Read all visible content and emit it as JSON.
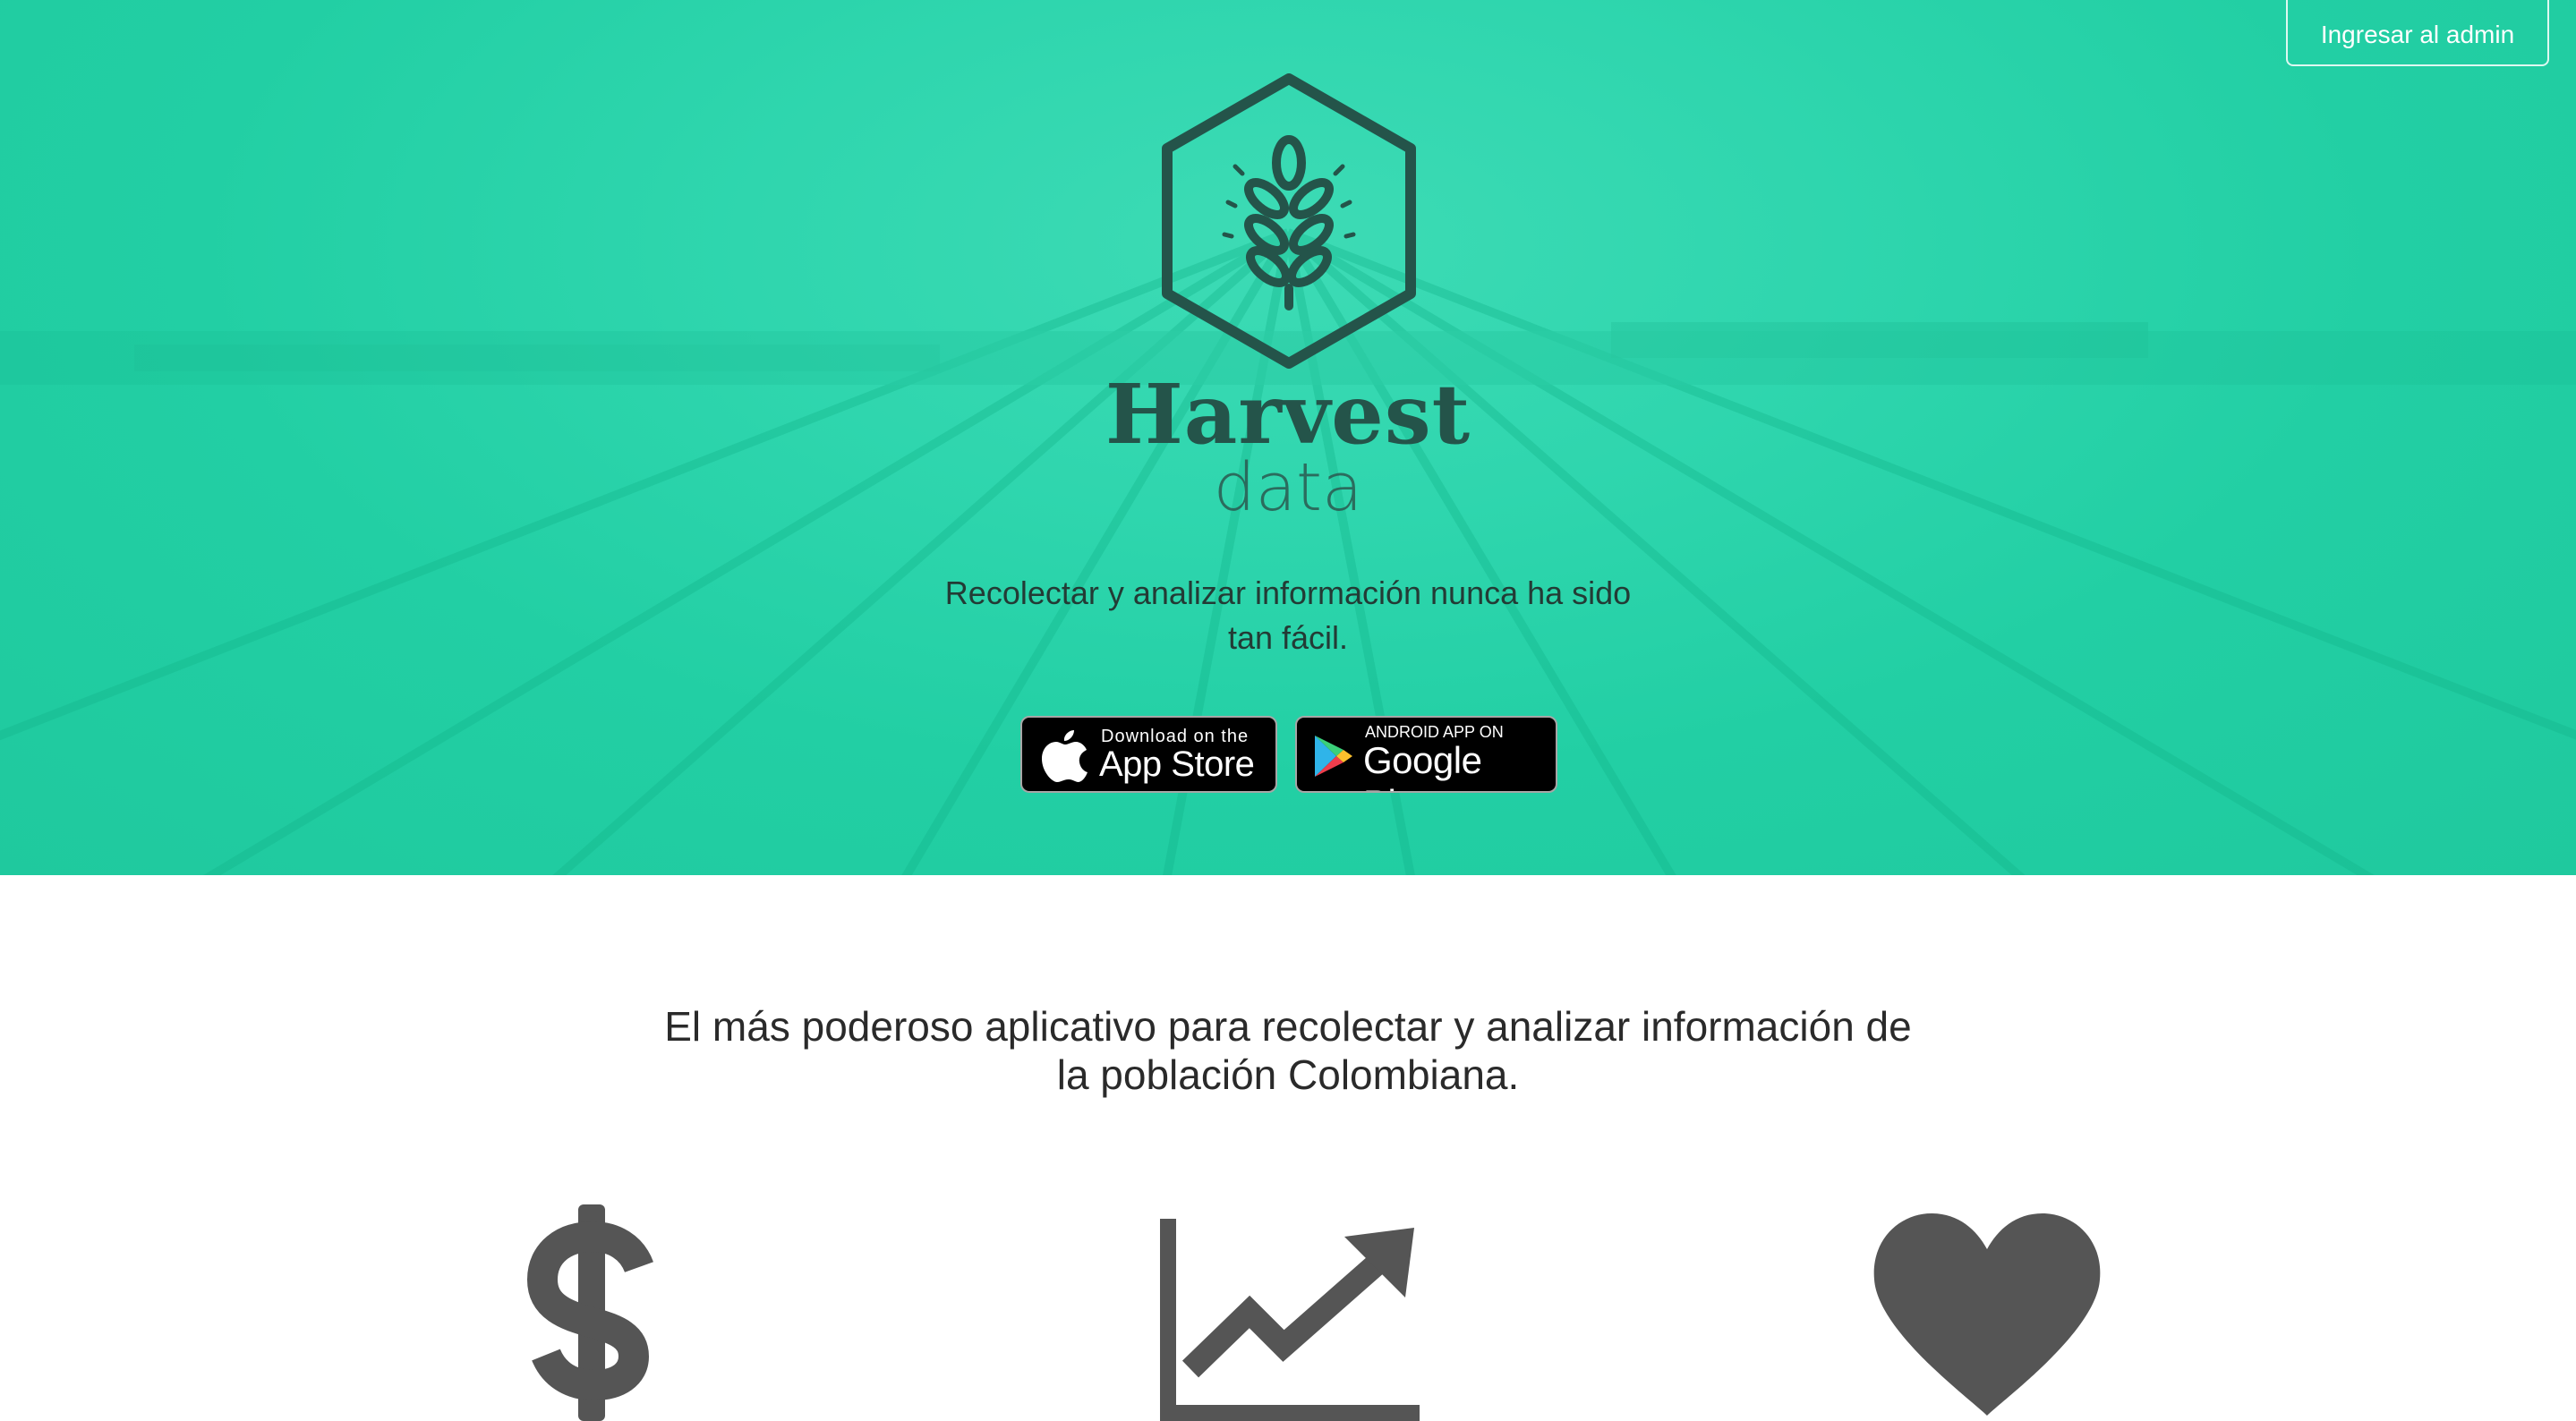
{
  "header": {
    "admin_button_label": "Ingresar al admin"
  },
  "hero": {
    "brand_title": "Harvest",
    "brand_subtitle": "data",
    "tagline_line1": "Recolectar y analizar información nunca ha sido",
    "tagline_line2": "tan fácil.",
    "background_color": "#22cfa4",
    "logo_color": "#24544a"
  },
  "store_buttons": {
    "appstore_small": "Download on the",
    "appstore_big": "App Store",
    "googleplay_small": "ANDROID APP ON",
    "googleplay_big": "Google Play"
  },
  "features": {
    "headline_line1": "El más poderoso aplicativo para recolectar y analizar información de",
    "headline_line2": "la población Colombiana.",
    "icons": [
      "dollar-icon",
      "trending-up-chart-icon",
      "heart-icon"
    ],
    "icon_color": "#555555"
  }
}
